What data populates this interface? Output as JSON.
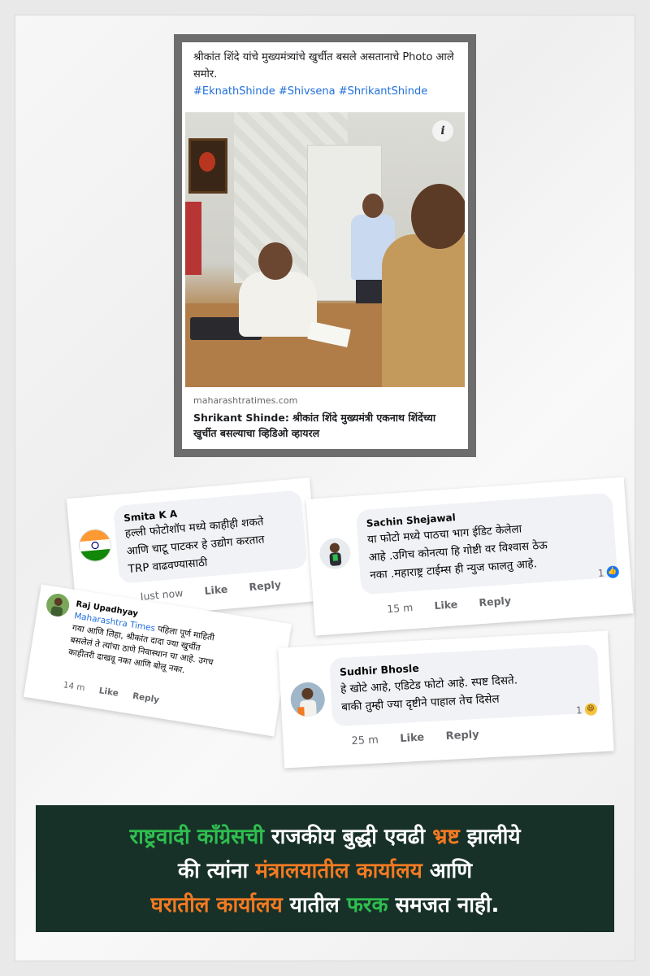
{
  "post": {
    "caption": "श्रीकांत शिंदे यांचे मुख्यमंत्र्यांचे खुर्चीत बसले असतानाचे Photo आले समोर.",
    "hashtags": "#EknathShinde #Shivsena #ShrikantShinde",
    "domain": "maharashtratimes.com",
    "headline": "Shrikant Shinde: श्रीकांत शिंदे मुख्यमंत्री एकनाथ शिंदेंच्या खुर्चीत बसल्याचा व्हिडिओ व्हायरल",
    "info_icon": "i"
  },
  "comments": [
    {
      "name": "Smita K A",
      "lines": [
        "हल्ली फोटोशॉप मध्ये काहीही शकते",
        "आणि चाटू पाटकर हे उद्योग करतात",
        "TRP वाढवण्यासाठी"
      ],
      "time": "Just now",
      "like": "Like",
      "reply": "Reply"
    },
    {
      "name": "Sachin Shejawal",
      "lines": [
        "या फोटो मध्ये पाठचा भाग ईडिट केलेला",
        "आहे .उगिच कोनत्या हि गोष्टी वर विश्वास ठेऊ",
        "नका .महाराष्ट्र टाईम्स ही न्युज फालतु आहे."
      ],
      "time": "15 m",
      "like": "Like",
      "reply": "Reply",
      "reaction_count": "1"
    },
    {
      "name": "Raj Upadhyay",
      "mention": "Maharashtra Times",
      "first_line_rest": " पहिला पूर्ण माहिती",
      "lines": [
        "गया आणि लिहा, श्रीकांत दादा ज्या खुर्चीत",
        "बसलेलं  ते त्यांचा ठाणे निवास्थान चा आहे. उगच",
        "काहीतरी दाखवू नका आणि बोलू नका."
      ],
      "time": "14 m",
      "like": "Like",
      "reply": "Reply"
    },
    {
      "name": "Sudhir Bhosle",
      "lines": [
        "हे खोटे आहे, एडिटेड फोटो आहे. स्पष्ट दिसते.",
        "बाकी तुम्ही ज्या दृष्टीने पाहाल तेच दिसेल"
      ],
      "time": "25 m",
      "like": "Like",
      "reply": "Reply",
      "reaction_count": "1"
    }
  ],
  "banner": {
    "l1a": "राष्ट्रवादी काँग्रेसची",
    "l1b": " राजकीय बुद्धी एवढी ",
    "l1c": "भ्रष्ट",
    "l1d": " झालीये",
    "l2a": "की त्यांना ",
    "l2b": "मंत्रालयातील कार्यालय",
    "l2c": " आणि",
    "l3a": "घरातील कार्यालय",
    "l3b": " यातील ",
    "l3c": "फरक",
    "l3d": " समजत नाही."
  },
  "colors": {
    "banner_bg": "#173128",
    "green": "#2fbe4f",
    "orange": "#f47a22",
    "link": "#216fdb",
    "like_blue": "#1877f2"
  }
}
